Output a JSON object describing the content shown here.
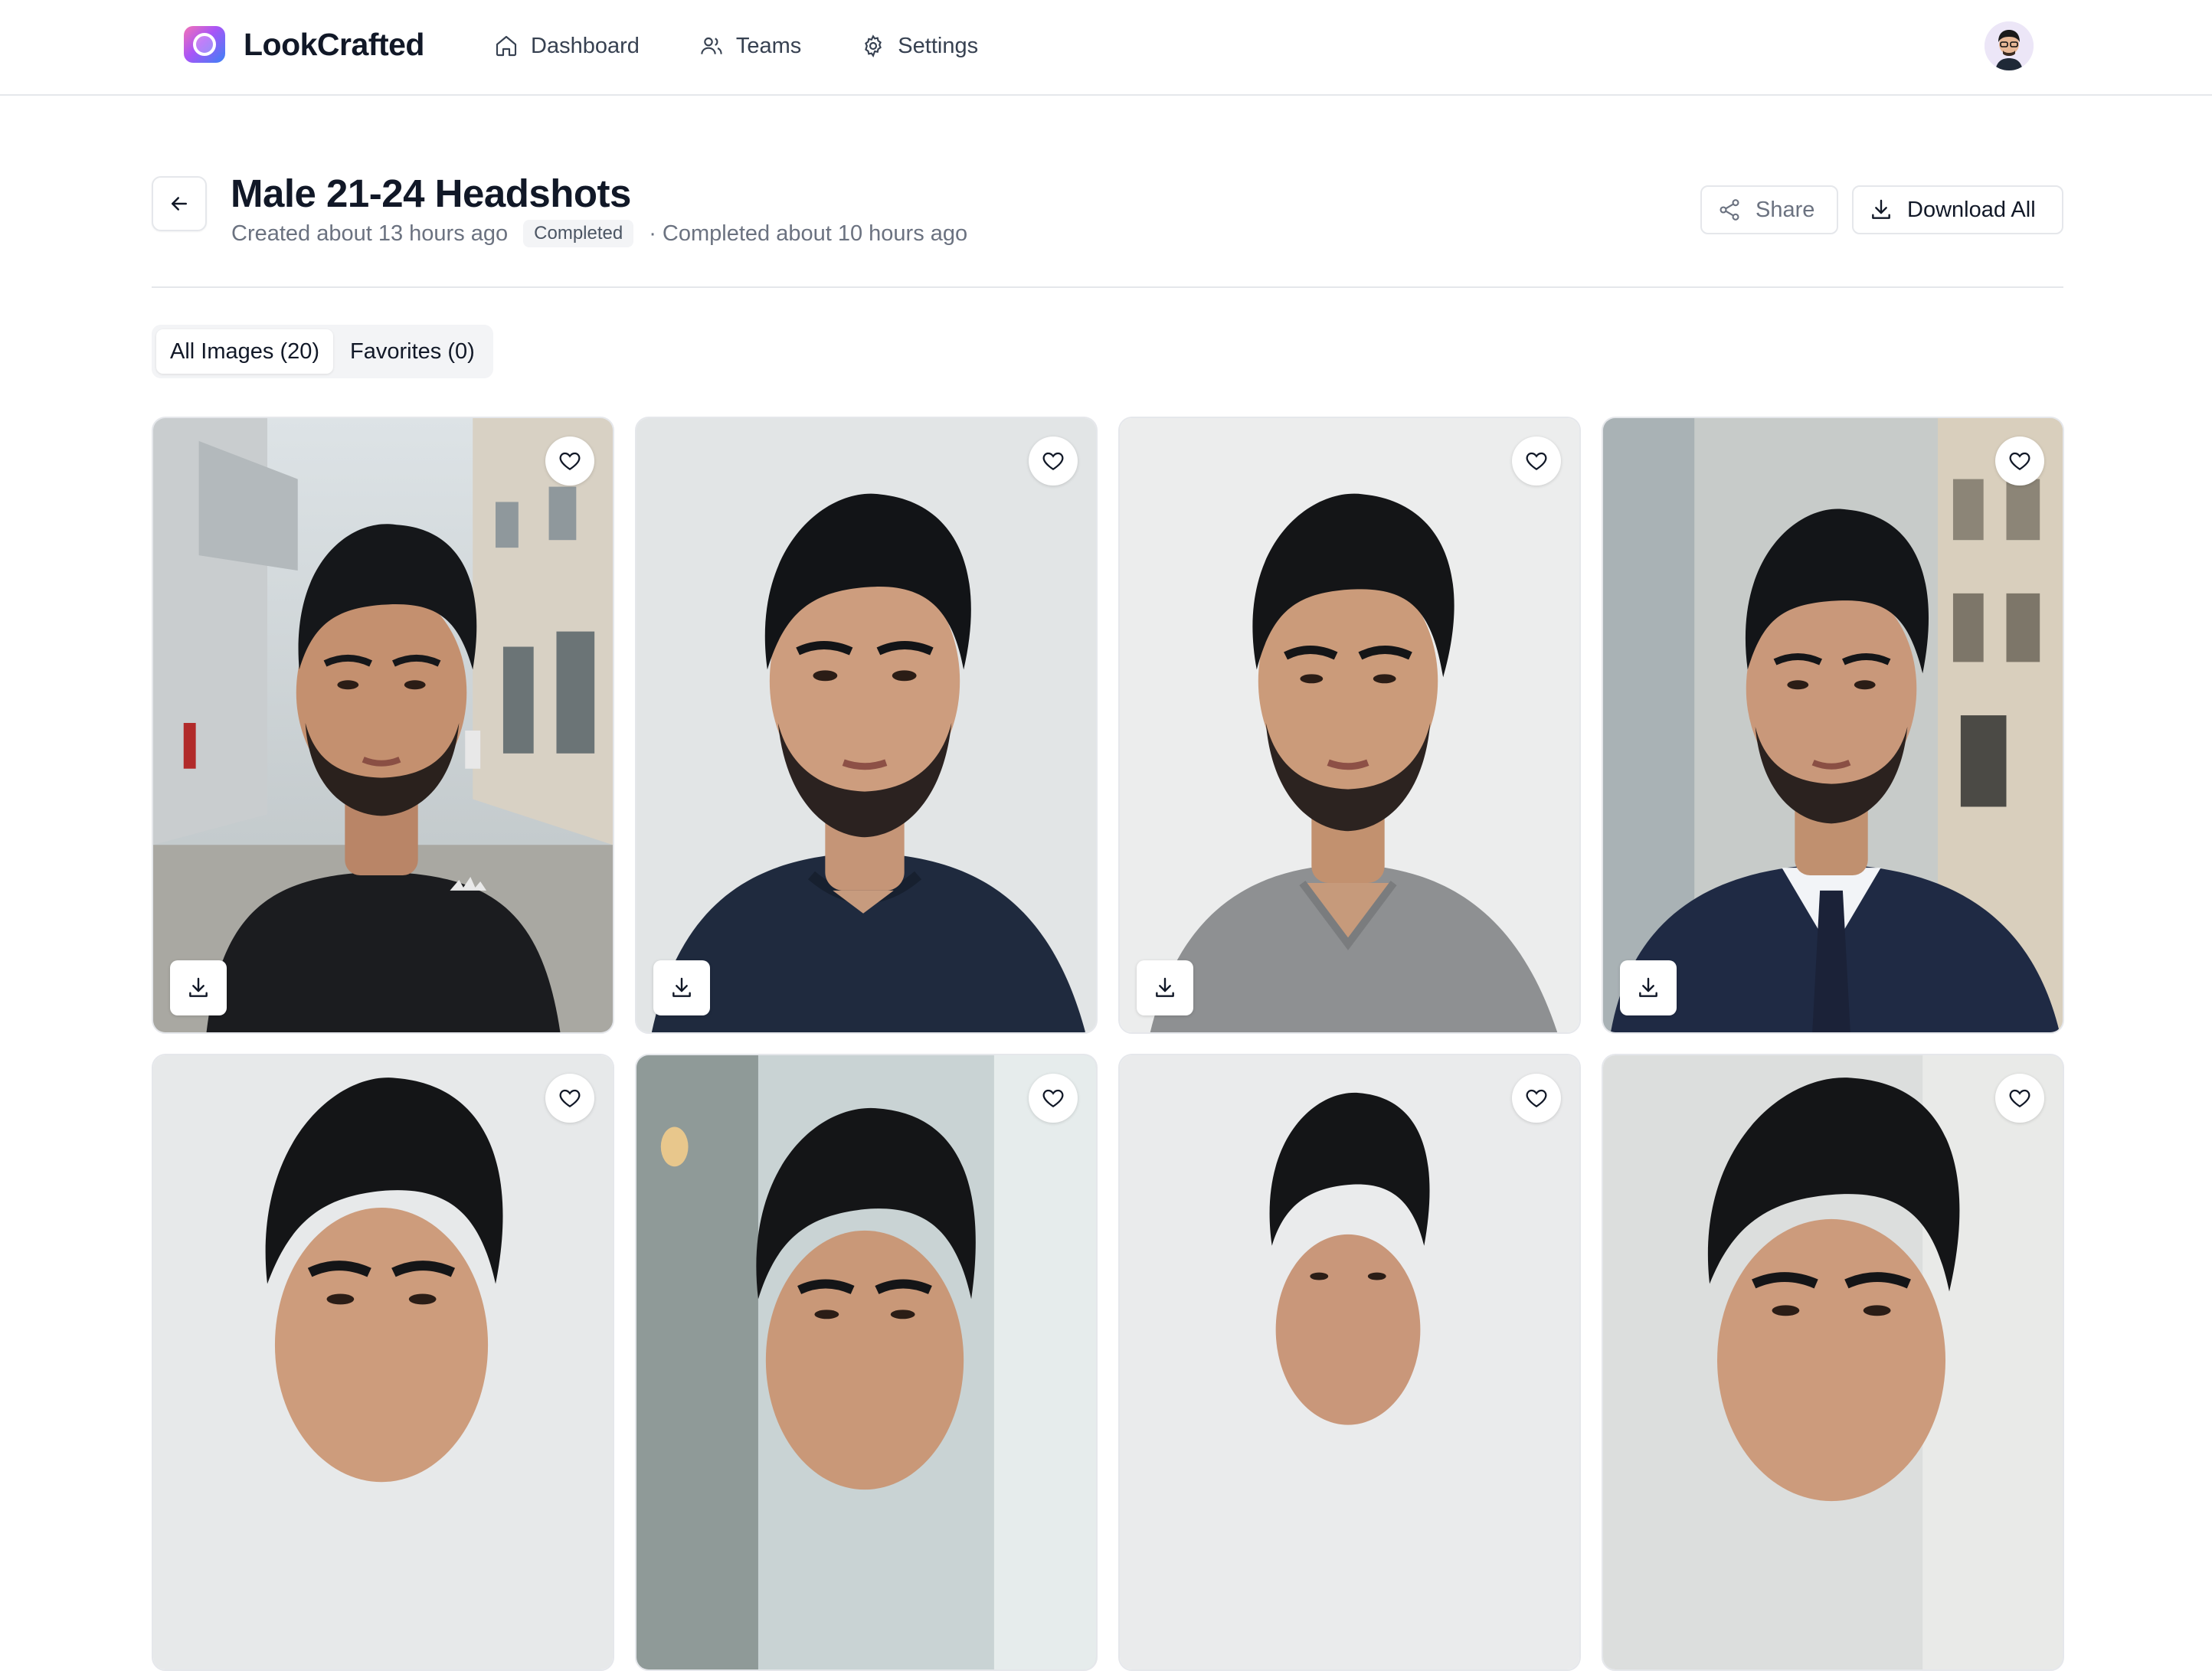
{
  "app": {
    "brand_name": "LookCrafted",
    "brand_icon": "camera-lens-icon"
  },
  "nav": {
    "items": [
      {
        "label": "Dashboard",
        "icon": "home-icon"
      },
      {
        "label": "Teams",
        "icon": "users-icon"
      },
      {
        "label": "Settings",
        "icon": "gear-icon"
      }
    ]
  },
  "header": {
    "title": "Male 21-24 Headshots",
    "created": "Created about 13 hours ago",
    "status_badge": "Completed",
    "completed": "· Completed about 10 hours ago",
    "share_label": "Share",
    "download_all_label": "Download All"
  },
  "tabs": [
    {
      "label": "All Images (20)",
      "active": true
    },
    {
      "label": "Favorites (0)",
      "active": false
    }
  ],
  "colors": {
    "accent_gradient_start": "#f472b6",
    "accent_gradient_end": "#3b82f6",
    "border": "#e5e7eb",
    "muted_text": "#6b7280"
  },
  "gallery": {
    "photos": [
      {
        "background": "street-outdoor",
        "shirt": "black-tshirt",
        "favorite": false,
        "download": true
      },
      {
        "background": "plain-light",
        "shirt": "navy-tshirt",
        "favorite": false,
        "download": true
      },
      {
        "background": "plain-light",
        "shirt": "grey-tshirt",
        "favorite": false,
        "download": true
      },
      {
        "background": "street-outdoor",
        "shirt": "suit-and-tie",
        "favorite": false,
        "download": true
      },
      {
        "background": "plain-light",
        "shirt": "",
        "favorite": false,
        "download": false
      },
      {
        "background": "cafe-indoor",
        "shirt": "",
        "favorite": false,
        "download": false
      },
      {
        "background": "plain-light",
        "shirt": "",
        "favorite": false,
        "download": false
      },
      {
        "background": "plain-light",
        "shirt": "",
        "favorite": false,
        "download": false
      }
    ]
  }
}
